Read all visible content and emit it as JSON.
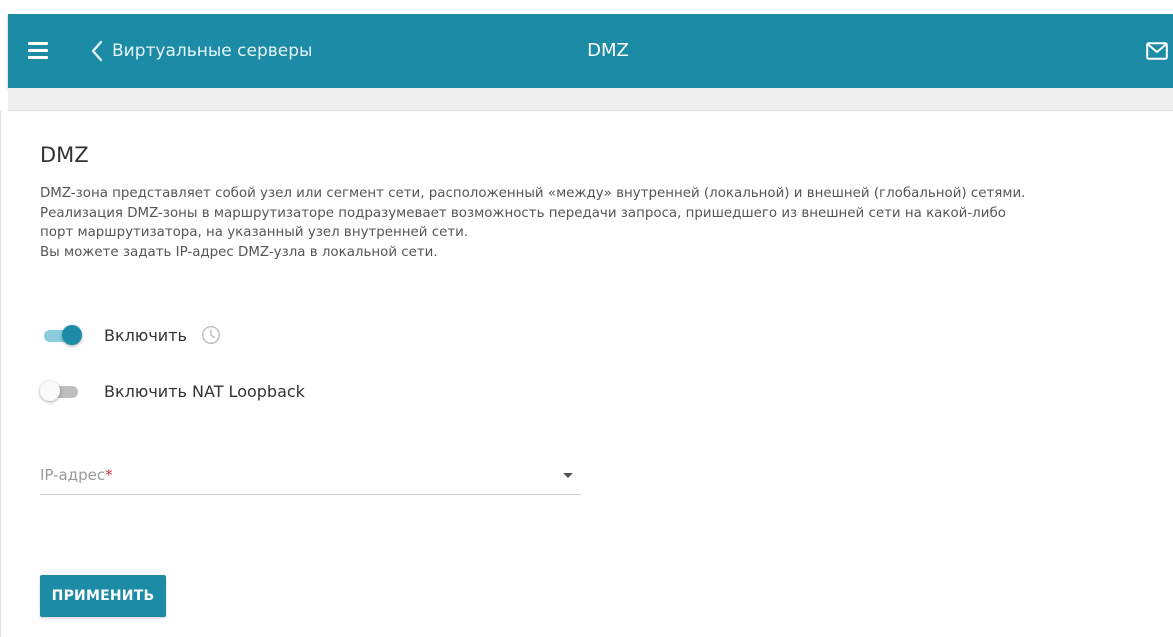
{
  "header": {
    "back_label": "Виртуальные серверы",
    "title": "DMZ",
    "menu_icon": "hamburger-menu-icon",
    "back_icon": "chevron-left-icon",
    "mail_icon": "mail-icon",
    "color": "#1c8ba6"
  },
  "section": {
    "title": "DMZ",
    "description": [
      "DMZ-зона представляет собой узел или сегмент сети, расположенный «между» внутренней (локальной) и внешней (глобальной) сетями.",
      "Реализация DMZ-зоны в маршрутизаторе подразумевает возможность передачи запроса, пришедшего из внешней сети на какой-либо",
      "порт маршрутизатора, на указанный узел внутренней сети.",
      "Вы можете задать IP-адрес DMZ-узла в локальной сети."
    ]
  },
  "toggles": {
    "enable": {
      "label": "Включить",
      "state": "on",
      "schedule_icon": "clock-icon"
    },
    "nat_loopback": {
      "label": "Включить NAT Loopback",
      "state": "off"
    }
  },
  "ip_field": {
    "placeholder": "IP-адрес",
    "required_mark": "*",
    "value": "",
    "dropdown_icon": "dropdown-arrow-icon"
  },
  "actions": {
    "apply_label": "ПРИМЕНИТЬ"
  },
  "colors": {
    "accent": "#1c8ba6",
    "toggle_track_on": "#8ccde0",
    "required": "#d0392b"
  }
}
